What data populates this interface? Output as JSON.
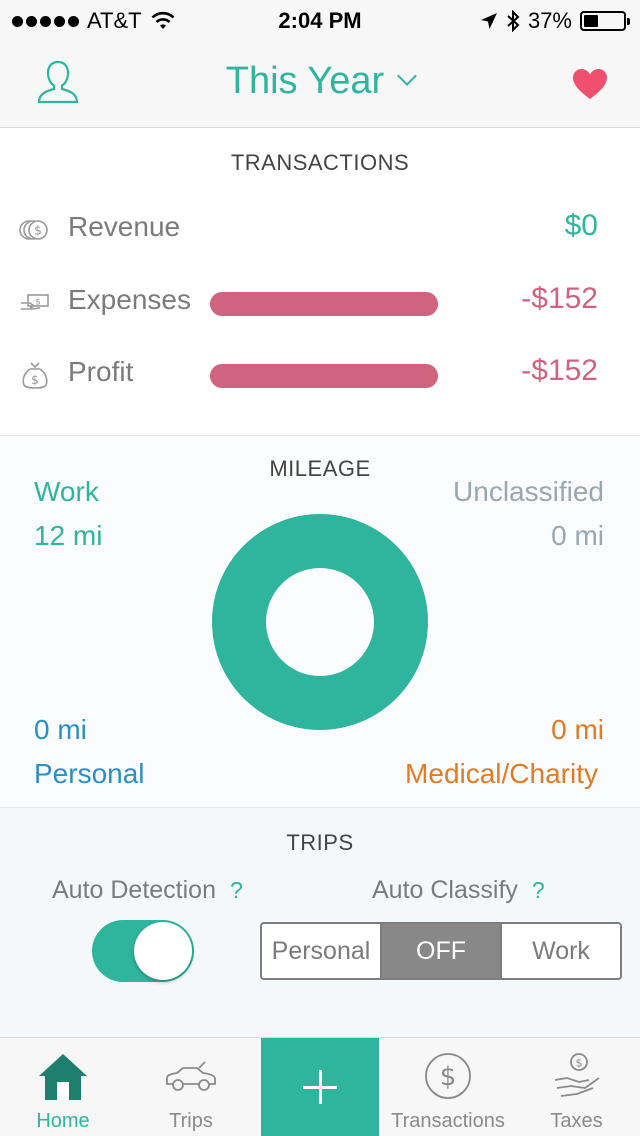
{
  "status_bar": {
    "carrier": "AT&T",
    "time": "2:04 PM",
    "battery": "37%",
    "battery_level": 0.37
  },
  "header": {
    "title": "This Year",
    "profile_icon": "person-outline-icon",
    "favorite_icon": "heart-icon"
  },
  "transactions": {
    "title": "TRANSACTIONS",
    "rows": [
      {
        "label": "Revenue",
        "value": "$0",
        "icon": "coins-icon"
      },
      {
        "label": "Expenses",
        "value": "-$152",
        "icon": "hand-money-icon"
      },
      {
        "label": "Profit",
        "value": "-$152",
        "icon": "money-bag-icon"
      }
    ]
  },
  "mileage": {
    "title": "MILEAGE",
    "work": {
      "label": "Work",
      "value": "12 mi"
    },
    "unclassified": {
      "label": "Unclassified",
      "value": "0 mi"
    },
    "personal": {
      "label": "Personal",
      "value": "0 mi"
    },
    "medical": {
      "label": "Medical/Charity",
      "value": "0 mi"
    }
  },
  "trips": {
    "title": "TRIPS",
    "auto_detection": {
      "label": "Auto Detection",
      "help": "?",
      "enabled": true
    },
    "auto_classify": {
      "label": "Auto Classify",
      "help": "?",
      "options": [
        "Personal",
        "OFF",
        "Work"
      ],
      "selected": "OFF"
    }
  },
  "tab_bar": {
    "tabs": [
      {
        "label": "Home",
        "icon": "home-icon",
        "active": true
      },
      {
        "label": "Trips",
        "icon": "car-icon",
        "active": false
      },
      {
        "label": "Transactions",
        "icon": "dollar-circle-icon",
        "active": false
      },
      {
        "label": "Taxes",
        "icon": "hand-money-icon",
        "active": false
      }
    ],
    "add_icon": "plus-icon"
  },
  "colors": {
    "accent": "#2fb59d",
    "negative": "#d0637e",
    "personal": "#2a8fc4",
    "medical": "#e07b27",
    "unclassified": "#9aa7b2"
  }
}
